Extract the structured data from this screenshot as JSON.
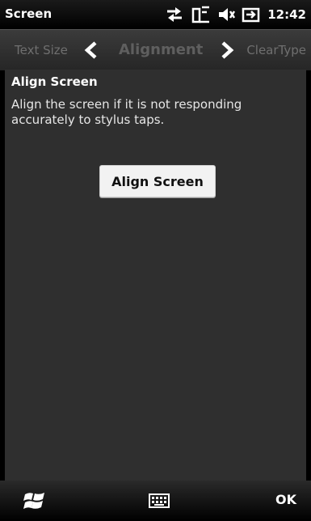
{
  "titlebar": {
    "app_title": "Screen",
    "clock": "12:42",
    "icons": [
      "connectivity-arrows-icon",
      "signal-icon",
      "volume-muted-icon",
      "battery-plug-icon"
    ]
  },
  "tabs": {
    "previous": "Text Size",
    "current": "Alignment",
    "next": "ClearType"
  },
  "content": {
    "heading": "Align Screen",
    "description": "Align the screen if it is not responding accurately to stylus taps.",
    "button_label": "Align Screen"
  },
  "bottombar": {
    "icons": [
      "windows-start-icon",
      "keyboard-icon"
    ],
    "ok_label": "OK"
  },
  "colors": {
    "background": "#000000",
    "content_bg": "#2f2f2f",
    "tab_text_dim": "#6f6f6f"
  }
}
